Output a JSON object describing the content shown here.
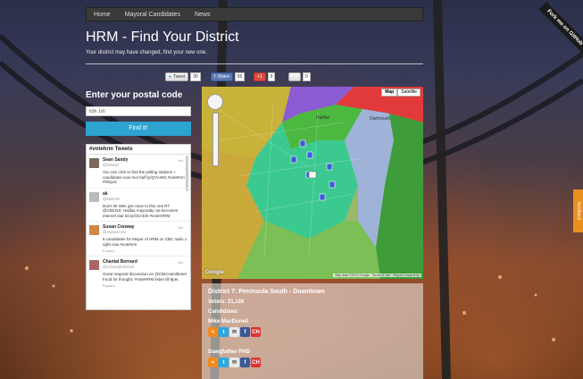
{
  "nav": {
    "items": [
      "Home",
      "Mayoral Candidates",
      "News"
    ]
  },
  "ribbon": "Fork me on GitHub",
  "header": {
    "title": "HRM - Find Your District",
    "subtitle": "Your district may have changed, find your new one."
  },
  "share": {
    "tweet_label": "Tweet",
    "tweet_count": "30",
    "fb_label": "Share",
    "fb_count": "56",
    "gplus_label": "+1",
    "gplus_count": "6",
    "other_label": "",
    "other_count": "0"
  },
  "search": {
    "heading": "Enter your postal code",
    "value": "b3h 1x6",
    "button": "Find It!"
  },
  "tweets": {
    "header": "#votehrm Tweets",
    "items": [
      {
        "name": "Sean Sandy",
        "handle": "@SeanH",
        "time": "5m",
        "body": "You can click to find the polling stations + candidates now too! buff.ly/QYruNG #votehrm #hfxpoli"
      },
      {
        "name": "ak",
        "handle": "@kaikHR",
        "time": "",
        "body": "Don't let Weir get close to this one RT @CBCNS: Halifax mayoralty cat becomes internet star bit.ly/OCr33h #voterHRM"
      },
      {
        "name": "Susan Conway",
        "handle": "@SuSocArt2",
        "time": "6m",
        "body": "6 candidates for Mayor of HRM on CBC radio 1 right now #votehrm",
        "expand": "Expand"
      },
      {
        "name": "Chantal Bernard",
        "handle": "@ChantalCBSNS",
        "time": "6m",
        "body": "Great mayoral discussion on @CBCHamiltonet Food for thought. #VoteHRM listen till 8pm.",
        "expand": "Expand"
      }
    ]
  },
  "map": {
    "type_map": "Map",
    "type_sat": "Satellite",
    "footer": "Map data ©2013 Google · Terms of Use · Report a map error",
    "logo": "Google",
    "labels": {
      "dartmouth": "Dartmouth",
      "halifax": "Halifax"
    }
  },
  "info": {
    "district": "District 7: Peninsula South - Downtown",
    "voters": "Voters: 21,126",
    "candidates_label": "Candidates:",
    "candidates": [
      "Mike MacDonell",
      "Dawgfather PHD"
    ]
  },
  "feedback": "feedback",
  "colors": {
    "accent": "#2da3cf",
    "district_highlight": "#3cc98f"
  }
}
